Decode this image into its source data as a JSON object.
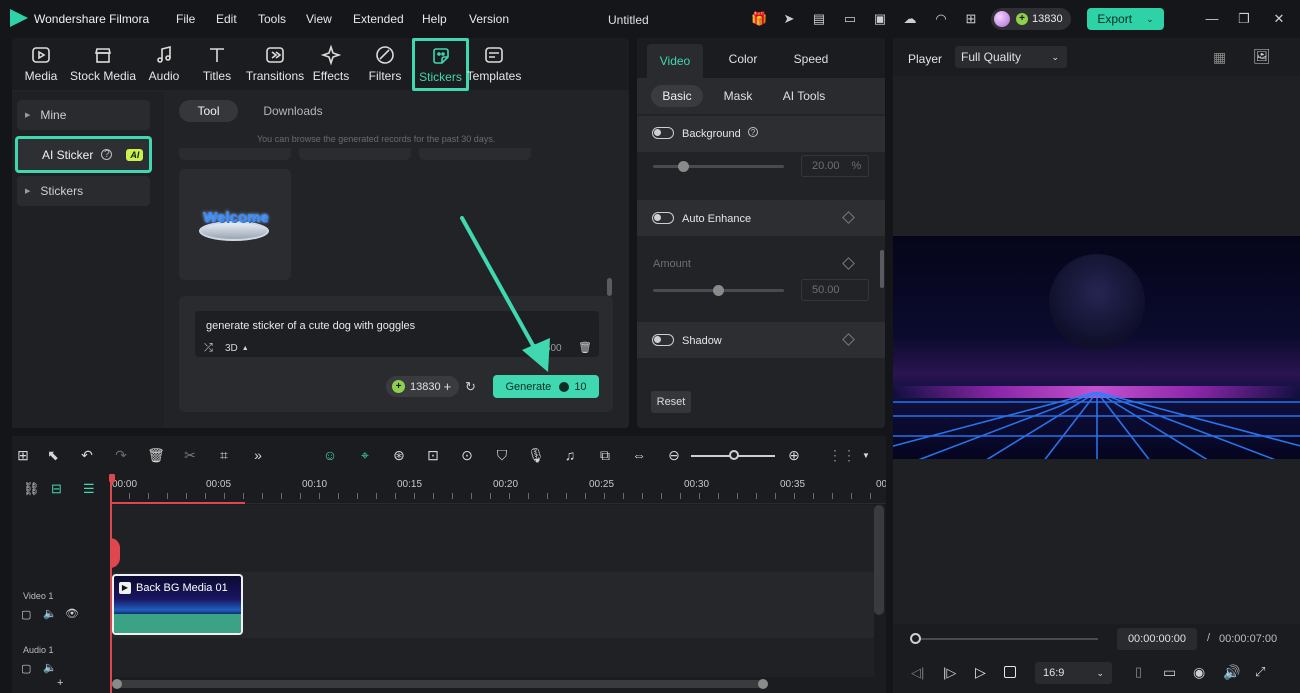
{
  "app": {
    "name": "Wondershare Filmora",
    "project_title": "Untitled",
    "credits": "13830",
    "export_label": "Export"
  },
  "menu": [
    "File",
    "Edit",
    "Tools",
    "View",
    "Extended",
    "Help",
    "Version"
  ],
  "media_tabs": [
    "Media",
    "Stock Media",
    "Audio",
    "Titles",
    "Transitions",
    "Effects",
    "Filters",
    "Stickers",
    "Templates"
  ],
  "sidebar": {
    "items": [
      {
        "label": "Mine"
      },
      {
        "label": "AI Sticker",
        "badge": "AI"
      },
      {
        "label": "Stickers"
      }
    ]
  },
  "sticker_panel": {
    "tabs": [
      "Tool",
      "Downloads"
    ],
    "notice": "You can browse the generated records for the past 30 days.",
    "thumb_text": "Welcome",
    "prompt_text": "generate sticker of a cute dog with goggles",
    "style_label": "3D",
    "char_count": "45/500",
    "credits": "13830",
    "generate_label": "Generate",
    "generate_cost": "10"
  },
  "properties": {
    "tabs": [
      "Video",
      "Color",
      "Speed"
    ],
    "subtabs": [
      "Basic",
      "Mask",
      "AI Tools"
    ],
    "background_label": "Background",
    "background_value": "20.00",
    "background_unit": "%",
    "auto_enhance_label": "Auto Enhance",
    "amount_label": "Amount",
    "amount_value": "50.00",
    "shadow_label": "Shadow",
    "reset_label": "Reset"
  },
  "player": {
    "label": "Player",
    "quality": "Full Quality",
    "current_time": "00:00:00:00",
    "separator": "/",
    "total_time": "00:00:07:00",
    "aspect": "16:9"
  },
  "timeline": {
    "ruler": [
      "00:00",
      "00:05",
      "00:10",
      "00:15",
      "00:20",
      "00:25",
      "00:30",
      "00:35",
      "00:"
    ],
    "tracks": [
      {
        "name": "Video 1"
      },
      {
        "name": "Audio 1"
      }
    ],
    "clip_label": "Back BG Media 01"
  },
  "colors": {
    "accent": "#3fd8b0",
    "background": "#141518",
    "panel": "#222326",
    "playhead": "#e0474c"
  }
}
